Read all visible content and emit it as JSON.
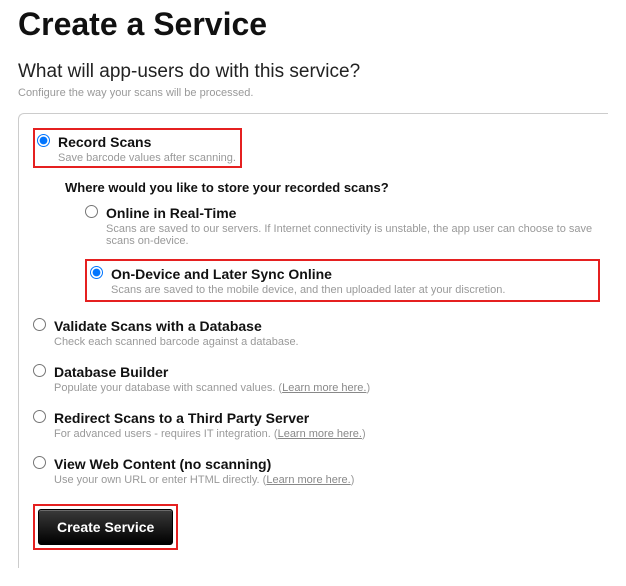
{
  "title": "Create a Service",
  "question": "What will app-users do with this service?",
  "caption": "Configure the way your scans will be processed.",
  "options": {
    "record": {
      "label": "Record Scans",
      "desc": "Save barcode values after scanning.",
      "selected": true,
      "storage_question": "Where would you like to store your recorded scans?",
      "storage": {
        "online": {
          "label": "Online in Real-Time",
          "desc": "Scans are saved to our servers. If Internet connectivity is unstable, the app user can choose to save scans on-device.",
          "selected": false
        },
        "ondevice": {
          "label": "On-Device and Later Sync Online",
          "desc": "Scans are saved to the mobile device, and then uploaded later at your discretion.",
          "selected": true
        }
      }
    },
    "validate": {
      "label": "Validate Scans with a Database",
      "desc": "Check each scanned barcode against a database."
    },
    "builder": {
      "label": "Database Builder",
      "desc": "Populate your database with scanned values. (",
      "learn": "Learn more here.",
      "desc_close": ")"
    },
    "redirect": {
      "label": "Redirect Scans to a Third Party Server",
      "desc": "For advanced users - requires IT integration. (",
      "learn": "Learn more here.",
      "desc_close": ")"
    },
    "web": {
      "label": "View Web Content (no scanning)",
      "desc": "Use your own URL or enter HTML directly. (",
      "learn": "Learn more here.",
      "desc_close": ")"
    }
  },
  "create_button": "Create Service"
}
